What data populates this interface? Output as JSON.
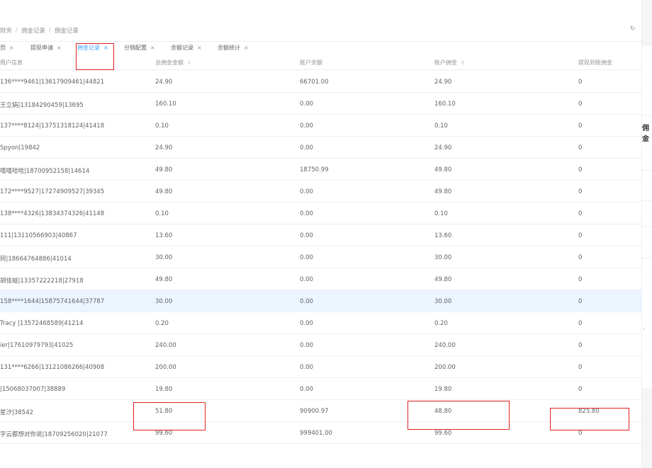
{
  "breadcrumb": [
    "财务",
    "佣金记录",
    "佣金记录"
  ],
  "tabs": [
    {
      "label": "页",
      "active": false
    },
    {
      "label": "提现申请",
      "active": false
    },
    {
      "label": "佣金记录",
      "active": true
    },
    {
      "label": "分销配置",
      "active": false
    },
    {
      "label": "余额记录",
      "active": false
    },
    {
      "label": "余额统计",
      "active": false
    }
  ],
  "tab_close": "×",
  "refresh_icon": "↻",
  "table": {
    "headers": [
      "用户信息",
      "总佣金金额",
      "账户余额",
      "账户佣金",
      "提现到账佣金"
    ],
    "sort_glyph": "⇕",
    "rows": [
      [
        "136****9461|13617909461|44821",
        "24.90",
        "66701.00",
        "24.90",
        "0"
      ],
      [
        "王立娟|13184290459|13695",
        "160.10",
        "0.00",
        "160.10",
        "0"
      ],
      [
        "137****8124|13751318124|41418",
        "0.10",
        "0.00",
        "0.10",
        "0"
      ],
      [
        "Spyon|19842",
        "24.90",
        "0.00",
        "24.90",
        "0"
      ],
      [
        "嘻嘻哈哈|18700952158|14614",
        "49.80",
        "18750.99",
        "49.80",
        "0"
      ],
      [
        "172****9527|17274909527|39345",
        "49.80",
        "0.00",
        "49.80",
        "0"
      ],
      [
        "138****4326|13834374326|41148",
        "0.10",
        "0.00",
        "0.10",
        "0"
      ],
      [
        "111|13110566903|40867",
        "13.60",
        "0.00",
        "13.60",
        "0"
      ],
      [
        "珂|18664764886|41014",
        "30.00",
        "0.00",
        "30.00",
        "0"
      ],
      [
        "胡佳蛙|13357222218|27918",
        "49.80",
        "0.00",
        "49.80",
        "0"
      ],
      [
        "158****1644|15875741644|37787",
        "30.00",
        "0.00",
        "30.00",
        "0"
      ],
      [
        "Tracy |13572468589|41214",
        "0.20",
        "0.00",
        "0.20",
        "0"
      ],
      [
        "ier|17610979793|41025",
        "240.00",
        "0.00",
        "240.00",
        "0"
      ],
      [
        "131****6266|13121086266|40908",
        "200.00",
        "0.00",
        "200.00",
        "0"
      ],
      [
        "|15068037007|38889",
        "19.80",
        "0.00",
        "19.80",
        "0"
      ],
      [
        "星汐|38542",
        "51.80",
        "90900.97",
        "48.80",
        "825.80"
      ],
      [
        "字云都想对你说|18709256020|21077",
        "99.60",
        "999401.00",
        "99.60",
        "0"
      ]
    ]
  },
  "side_panel_text": "佣金",
  "side_arrow": "›",
  "colors": {
    "accent": "#409eff",
    "highlight_row": "#ecf5ff",
    "annotation_box": "#e02020"
  }
}
